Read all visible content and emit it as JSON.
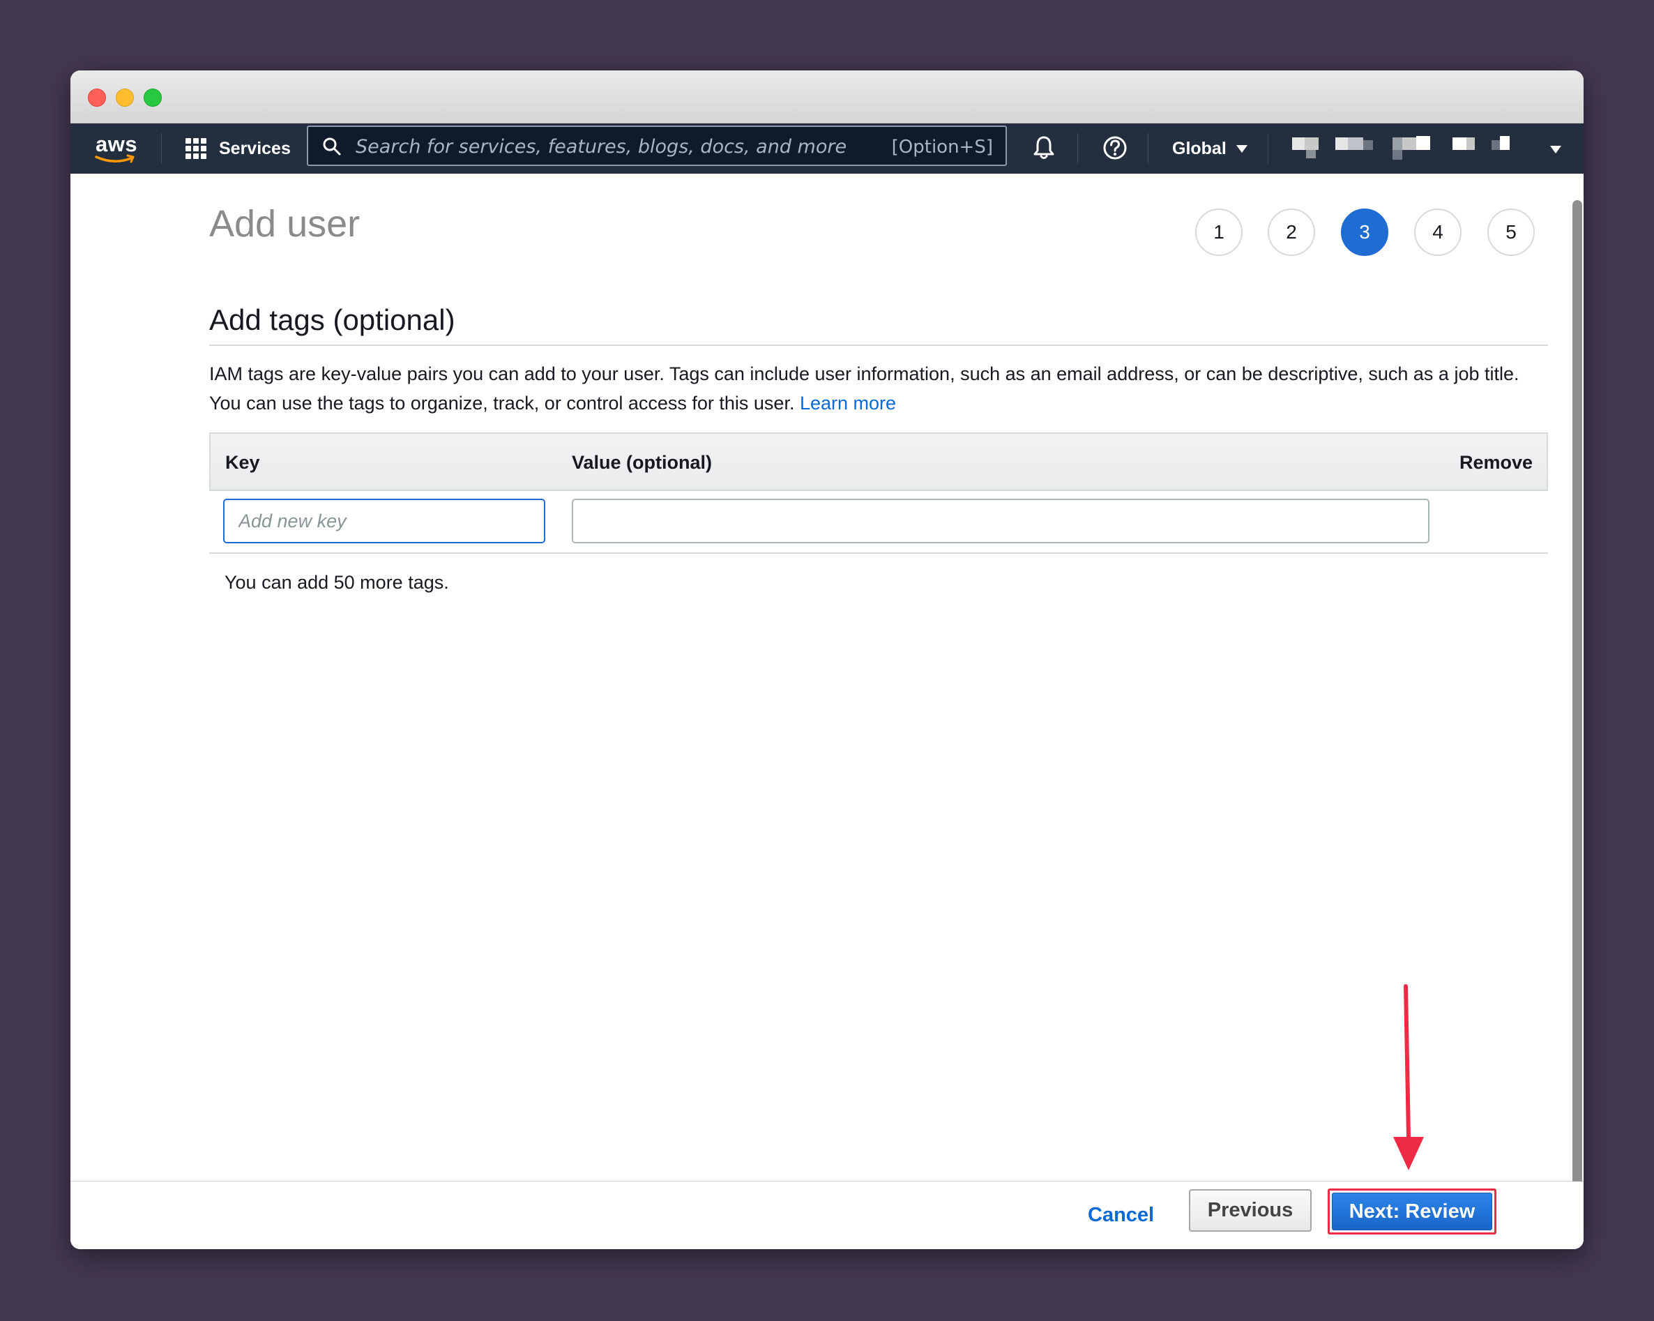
{
  "navbar": {
    "logo_text": "aws",
    "services_label": "Services",
    "search_placeholder": "Search for services, features, blogs, docs, and more",
    "search_shortcut": "[Option+S]",
    "region_label": "Global",
    "icons": [
      "grid-icon",
      "search-icon",
      "bell-icon",
      "help-icon",
      "chevron-down-icon"
    ]
  },
  "page": {
    "title": "Add user",
    "steps": [
      "1",
      "2",
      "3",
      "4",
      "5"
    ],
    "active_step": "3"
  },
  "section": {
    "title": "Add tags (optional)",
    "description": "IAM tags are key-value pairs you can add to your user. Tags can include user information, such as an email address, or can be descriptive, such as a job title. You can use the tags to organize, track, or control access for this user.",
    "learn_more": "Learn more"
  },
  "table": {
    "headers": {
      "key": "Key",
      "value": "Value (optional)",
      "remove": "Remove"
    },
    "key_placeholder": "Add new key",
    "key_value": "",
    "value_value": ""
  },
  "tags_remaining": "You can add 50 more tags.",
  "footer": {
    "cancel": "Cancel",
    "previous": "Previous",
    "next": "Next: Review"
  },
  "colors": {
    "navbar_bg": "#232f3e",
    "primary": "#1f6cd2",
    "link": "#0a6ad6",
    "annotation": "#ed2b45",
    "desktop_bg": "#433851"
  }
}
